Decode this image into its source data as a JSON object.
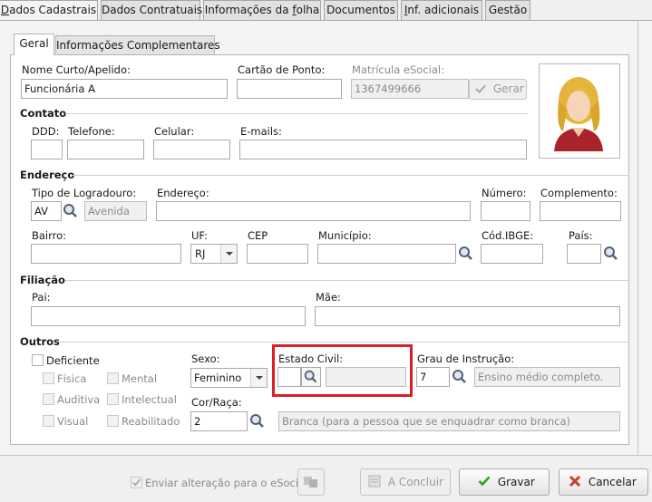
{
  "top_tabs": [
    "Dados Cadastrais",
    "Dados Contratuais",
    "Informações da folha",
    "Documentos",
    "Inf. adicionais",
    "Gestão"
  ],
  "sub_tabs": [
    "Geral",
    "Informações Complementares"
  ],
  "identity": {
    "nome_label": "Nome Curto/Apelido:",
    "nome_value": "Funcionária A",
    "cartao_label": "Cartão de Ponto:",
    "matricula_label": "Matrícula eSocial:",
    "matricula_value": "1367499666",
    "gerar_label": "Gerar"
  },
  "contato": {
    "title": "Contato",
    "ddd_label": "DDD:",
    "telefone_label": "Telefone:",
    "celular_label": "Celular:",
    "emails_label": "E-mails:"
  },
  "endereco": {
    "title": "Endereço",
    "tipo_label": "Tipo de Logradouro:",
    "tipo_code": "AV",
    "tipo_desc": "Avenida",
    "endereco_label": "Endereço:",
    "numero_label": "Número:",
    "complemento_label": "Complemento:",
    "bairro_label": "Bairro:",
    "uf_label": "UF:",
    "uf_value": "RJ",
    "cep_label": "CEP",
    "municipio_label": "Município:",
    "ibge_label": "Cód.IBGE:",
    "pais_label": "País:"
  },
  "filiacao": {
    "title": "Filiação",
    "pai_label": "Pai:",
    "mae_label": "Mãe:"
  },
  "outros": {
    "title": "Outros",
    "deficiente_label": "Deficiente",
    "deficiencias": [
      "Física",
      "Mental",
      "Auditiva",
      "Intelectual",
      "Visual",
      "Reabilitado"
    ],
    "sexo_label": "Sexo:",
    "sexo_value": "Feminino",
    "estado_civil_label": "Estado Civil:",
    "grau_label": "Grau de Instrução:",
    "grau_code": "7",
    "grau_desc": "Ensino médio completo.",
    "cor_label": "Cor/Raça:",
    "cor_code": "2",
    "cor_desc": "Branca (para a pessoa que se enquadrar como branca)"
  },
  "footer": {
    "esocial_label": "Enviar alteração para o eSocial",
    "concluir_label": "A Concluir",
    "gravar_label": "Gravar",
    "cancelar_label": "Cancelar"
  },
  "colors": {
    "highlight": "#d9202a",
    "tab_border": "#a7a7a7",
    "ok_green": "#3a9a2a",
    "cancel_red": "#d03a2a"
  }
}
